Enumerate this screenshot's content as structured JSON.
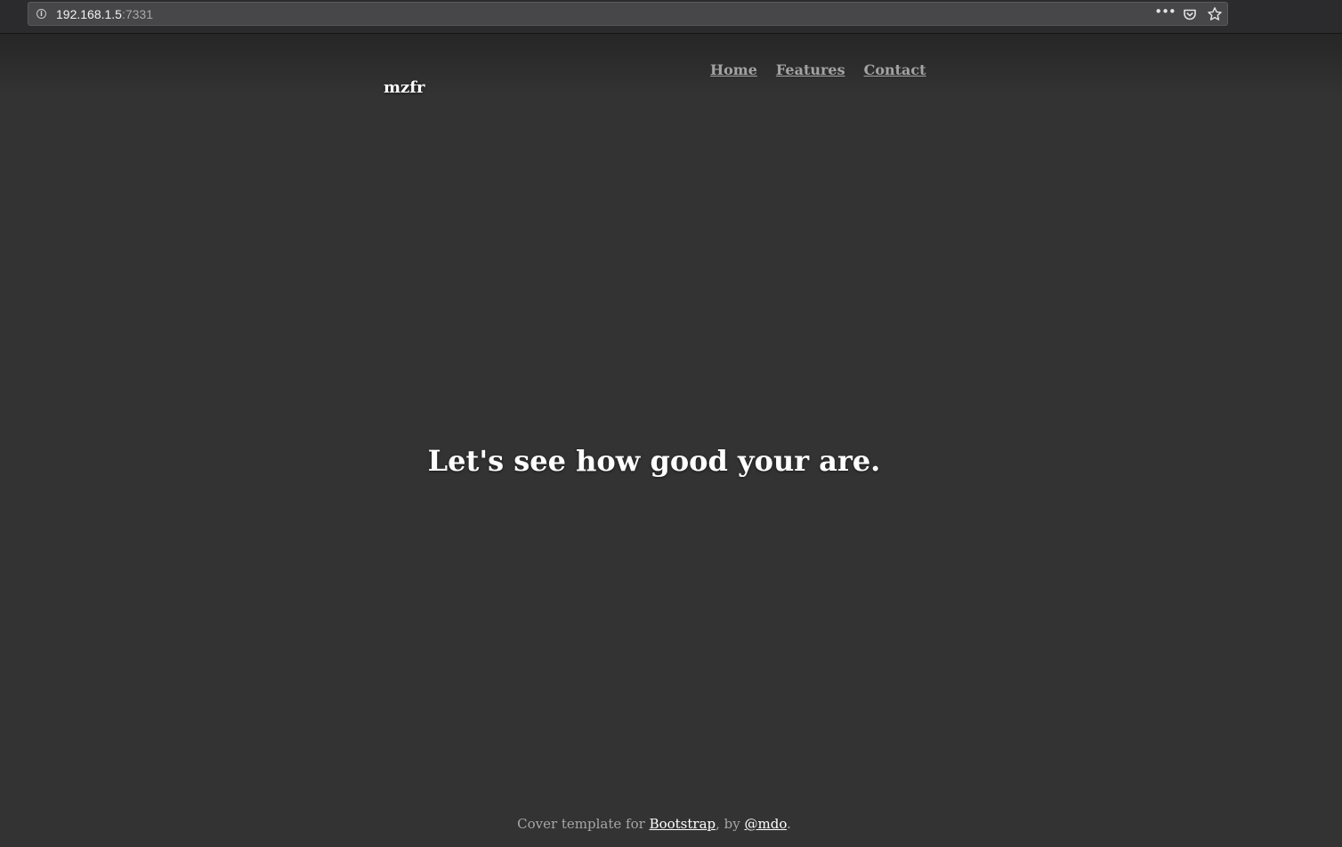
{
  "browser": {
    "url_host": "192.168.1.5",
    "url_port": ":7331",
    "icons": [
      "info-icon",
      "more-dots-icon",
      "pocket-icon",
      "bookmark-star-icon"
    ]
  },
  "masthead": {
    "brand": "mzfr",
    "nav": [
      {
        "label": "Home"
      },
      {
        "label": "Features"
      },
      {
        "label": "Contact"
      }
    ]
  },
  "main": {
    "headline": "Let's see how good your are."
  },
  "footer": {
    "prefix": "Cover template for ",
    "bootstrap_link": "Bootstrap",
    "middle": ", by ",
    "author_link": "@mdo",
    "suffix": "."
  },
  "colors": {
    "page_background": "#333333",
    "text_primary": "#ffffff",
    "nav_link": "#a3a3a3",
    "footer_text": "#a6a6a6",
    "browser_toolbar": "#2b2b2d",
    "urlbar": "#474749"
  }
}
